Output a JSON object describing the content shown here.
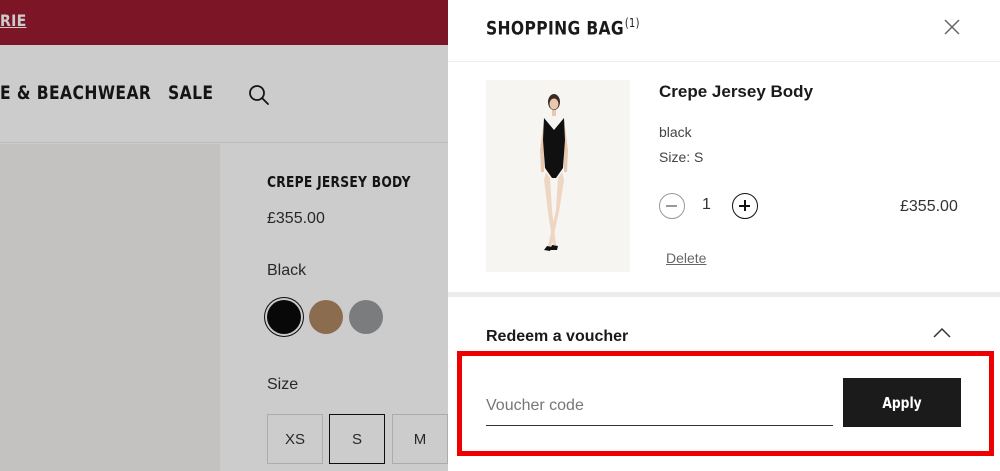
{
  "background_page": {
    "promo_link": "RIE",
    "nav": {
      "items": [
        {
          "label": "E & BEACHWEAR"
        },
        {
          "label": "SALE"
        }
      ]
    },
    "product": {
      "title": "CREPE JERSEY BODY",
      "price": "£355.00",
      "selected_color": "Black",
      "swatches": [
        {
          "name": "black",
          "color": "#0a0a0a"
        },
        {
          "name": "tan",
          "color": "#b08863"
        },
        {
          "name": "grey",
          "color": "#9a9c9d"
        }
      ],
      "size_label": "Size",
      "sizes": [
        "XS",
        "S",
        "M"
      ],
      "selected_size": "S"
    }
  },
  "drawer": {
    "title": "SHOPPING BAG",
    "item_count": "(1)",
    "item": {
      "name": "Crepe Jersey Body",
      "color": "black",
      "size": "Size: S",
      "quantity": "1",
      "price": "£355.00",
      "delete_label": "Delete"
    },
    "voucher": {
      "title": "Redeem a voucher",
      "placeholder": "Voucher code",
      "apply_label": "Apply"
    }
  },
  "colors": {
    "promo_bar": "#9b1b30",
    "highlight": "#ee0000",
    "apply_button": "#1b1b1b"
  }
}
